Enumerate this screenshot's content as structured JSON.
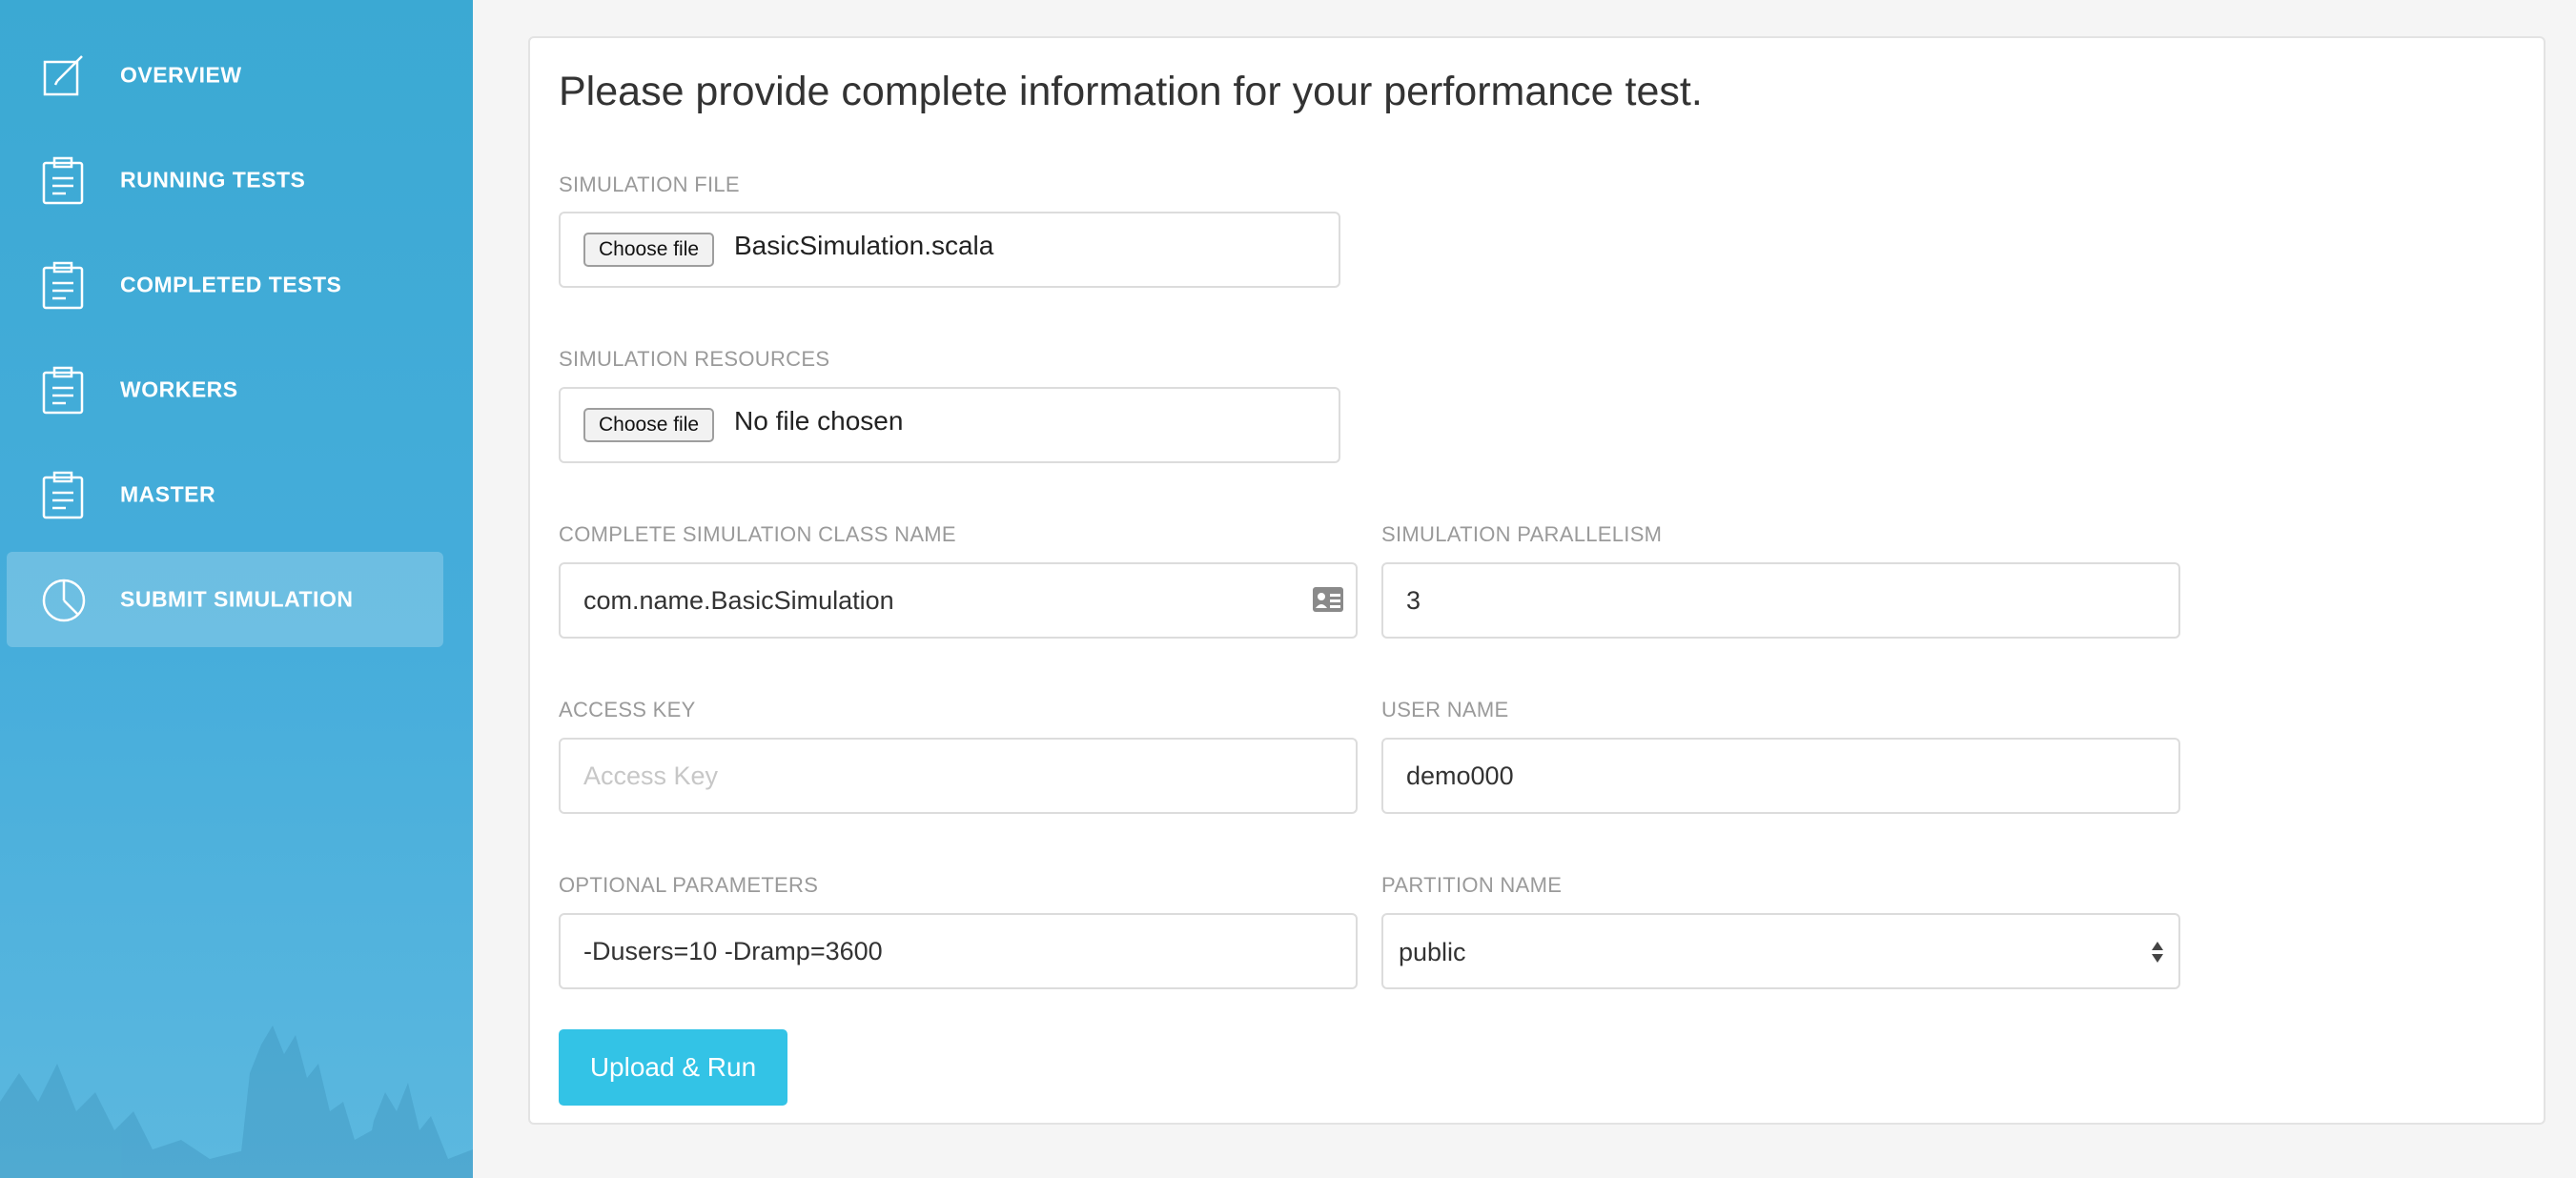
{
  "colors": {
    "sidebar": "#3ba9d3",
    "accent": "#33c3e6",
    "page_background": "#f5f5f5"
  },
  "sidebar": {
    "items": [
      {
        "label": "OVERVIEW",
        "icon": "edit-icon",
        "active": false
      },
      {
        "label": "RUNNING TESTS",
        "icon": "clipboard-icon",
        "active": false
      },
      {
        "label": "COMPLETED TESTS",
        "icon": "clipboard-icon",
        "active": false
      },
      {
        "label": "WORKERS",
        "icon": "clipboard-icon",
        "active": false
      },
      {
        "label": "MASTER",
        "icon": "clipboard-icon",
        "active": false
      },
      {
        "label": "SUBMIT SIMULATION",
        "icon": "pie-chart-icon",
        "active": true
      }
    ]
  },
  "form": {
    "heading": "Please provide complete information for your performance test.",
    "simulation_file": {
      "label": "SIMULATION FILE",
      "button": "Choose file",
      "file_name": "BasicSimulation.scala"
    },
    "simulation_resources": {
      "label": "SIMULATION RESOURCES",
      "button": "Choose file",
      "file_name": "No file chosen"
    },
    "class_name": {
      "label": "COMPLETE SIMULATION CLASS NAME",
      "value": "com.name.BasicSimulation",
      "icon": "contact-card-icon"
    },
    "parallelism": {
      "label": "SIMULATION PARALLELISM",
      "value": "3"
    },
    "access_key": {
      "label": "ACCESS KEY",
      "value": "",
      "placeholder": "Access Key"
    },
    "user_name": {
      "label": "USER NAME",
      "value": "demo000"
    },
    "optional_parameters": {
      "label": "OPTIONAL PARAMETERS",
      "value": "-Dusers=10 -Dramp=3600"
    },
    "partition_name": {
      "label": "PARTITION NAME",
      "selected": "public"
    },
    "submit_label": "Upload & Run"
  }
}
